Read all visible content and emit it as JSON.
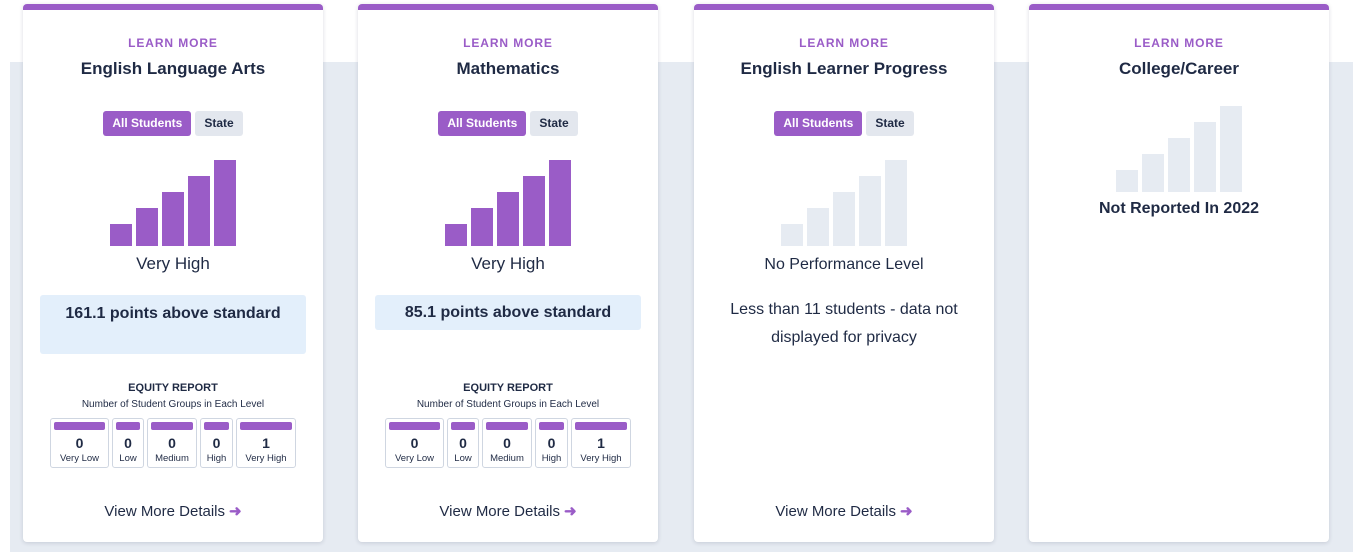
{
  "colors": {
    "accent": "#9a5cc7",
    "bar_gray": "#e6ebf2",
    "highlight": "#e3effb"
  },
  "cards": [
    {
      "learn_more": "LEARN MORE",
      "title": "English Language Arts",
      "toggle": {
        "active": "All Students",
        "inactive": "State"
      },
      "level": "Very High",
      "level_index": 5,
      "points": "161.1 points above standard",
      "equity": {
        "title": "EQUITY REPORT",
        "subtitle": "Number of Student Groups in Each Level",
        "levels": [
          {
            "label": "Very Low",
            "count": "0"
          },
          {
            "label": "Low",
            "count": "0"
          },
          {
            "label": "Medium",
            "count": "0"
          },
          {
            "label": "High",
            "count": "0"
          },
          {
            "label": "Very High",
            "count": "1"
          }
        ]
      },
      "details": "View More Details"
    },
    {
      "learn_more": "LEARN MORE",
      "title": "Mathematics",
      "toggle": {
        "active": "All Students",
        "inactive": "State"
      },
      "level": "Very High",
      "level_index": 5,
      "points": "85.1 points above standard",
      "equity": {
        "title": "EQUITY REPORT",
        "subtitle": "Number of Student Groups in Each Level",
        "levels": [
          {
            "label": "Very Low",
            "count": "0"
          },
          {
            "label": "Low",
            "count": "0"
          },
          {
            "label": "Medium",
            "count": "0"
          },
          {
            "label": "High",
            "count": "0"
          },
          {
            "label": "Very High",
            "count": "1"
          }
        ]
      },
      "details": "View More Details"
    },
    {
      "learn_more": "LEARN MORE",
      "title": "English Learner Progress",
      "toggle": {
        "active": "All Students",
        "inactive": "State"
      },
      "level": "No Performance Level",
      "level_index": 0,
      "privacy": "Less than 11 students - data not displayed for privacy",
      "details": "View More Details"
    },
    {
      "learn_more": "LEARN MORE",
      "title": "College/Career",
      "level_index": 0,
      "status": "Not Reported In 2022"
    }
  ]
}
